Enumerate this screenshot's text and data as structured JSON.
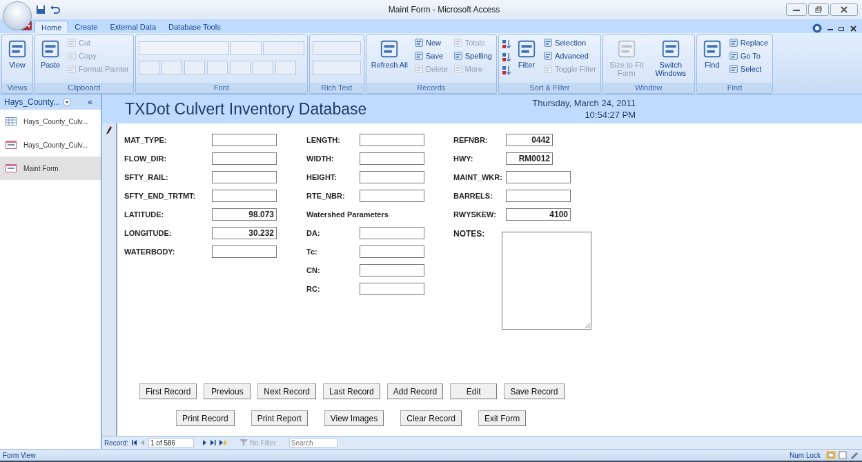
{
  "window": {
    "title": "Maint Form - Microsoft Access"
  },
  "ribbon_tabs": [
    {
      "label": "Home",
      "selected": true
    },
    {
      "label": "Create",
      "selected": false
    },
    {
      "label": "External Data",
      "selected": false
    },
    {
      "label": "Database Tools",
      "selected": false
    }
  ],
  "ribbon_groups": [
    {
      "name": "Views",
      "columns": [
        {
          "kind": "large",
          "items": [
            {
              "label": "View",
              "disabled": false
            }
          ]
        }
      ]
    },
    {
      "name": "Clipboard",
      "columns": [
        {
          "kind": "large",
          "items": [
            {
              "label": "Paste",
              "disabled": false
            }
          ]
        },
        {
          "kind": "small",
          "items": [
            {
              "label": "Cut",
              "disabled": true
            },
            {
              "label": "Copy",
              "disabled": true
            },
            {
              "label": "Format Painter",
              "disabled": true
            }
          ]
        }
      ]
    },
    {
      "name": "Font",
      "columns": [
        {
          "kind": "font"
        }
      ]
    },
    {
      "name": "Rich Text",
      "columns": [
        {
          "kind": "richtext"
        }
      ]
    },
    {
      "name": "Records",
      "columns": [
        {
          "kind": "large",
          "items": [
            {
              "label": "Refresh All",
              "disabled": false
            }
          ]
        },
        {
          "kind": "small",
          "items": [
            {
              "label": "New",
              "disabled": false
            },
            {
              "label": "Save",
              "disabled": false
            },
            {
              "label": "Delete",
              "disabled": true
            }
          ]
        },
        {
          "kind": "small",
          "items": [
            {
              "label": "Totals",
              "disabled": true
            },
            {
              "label": "Spelling",
              "disabled": false
            },
            {
              "label": "More",
              "disabled": true
            }
          ]
        }
      ]
    },
    {
      "name": "Sort & Filter",
      "columns": [
        {
          "kind": "sort"
        },
        {
          "kind": "large",
          "items": [
            {
              "label": "Filter",
              "disabled": false
            }
          ]
        },
        {
          "kind": "small",
          "items": [
            {
              "label": "Selection",
              "disabled": false
            },
            {
              "label": "Advanced",
              "disabled": false
            },
            {
              "label": "Toggle Filter",
              "disabled": true
            }
          ]
        }
      ]
    },
    {
      "name": "Window",
      "columns": [
        {
          "kind": "large",
          "items": [
            {
              "label": "Size to Fit Form",
              "disabled": true
            }
          ]
        },
        {
          "kind": "large",
          "items": [
            {
              "label": "Switch Windows",
              "disabled": false
            }
          ]
        }
      ]
    },
    {
      "name": "Find",
      "columns": [
        {
          "kind": "large",
          "items": [
            {
              "label": "Find",
              "disabled": false
            }
          ]
        },
        {
          "kind": "small",
          "items": [
            {
              "label": "Replace",
              "disabled": false
            },
            {
              "label": "Go To",
              "disabled": false
            },
            {
              "label": "Select",
              "disabled": false
            }
          ]
        }
      ]
    }
  ],
  "nav_pane": {
    "header": "Hays_County...",
    "collapse": "«",
    "items": [
      {
        "label": "Hays_County_Culv...",
        "kind": "table",
        "selected": false
      },
      {
        "label": "Hays_County_Culv...",
        "kind": "form",
        "selected": false
      },
      {
        "label": "Maint Form",
        "kind": "form",
        "selected": true
      }
    ]
  },
  "form": {
    "title": "TXDot Culvert Inventory Database",
    "date": "Thursday, March 24, 2011",
    "time": "10:54:27 PM",
    "columns": [
      [
        {
          "kind": "field",
          "label": "MAT_TYPE:"
        },
        {
          "kind": "field",
          "label": "FLOW_DIR:"
        },
        {
          "kind": "field",
          "label": "SFTY_RAIL:"
        },
        {
          "kind": "field",
          "label": "SFTY_END_TRTMT:"
        },
        {
          "kind": "field",
          "label": "LATITUDE:",
          "value": "98.073"
        },
        {
          "kind": "field",
          "label": "LONGITUDE:",
          "value": "30.232"
        },
        {
          "kind": "field",
          "label": "WATERBODY:"
        }
      ],
      [
        {
          "kind": "field",
          "label": "LENGTH:"
        },
        {
          "kind": "field",
          "label": "WIDTH:"
        },
        {
          "kind": "field",
          "label": "HEIGHT:"
        },
        {
          "kind": "field",
          "label": "RTE_NBR:"
        },
        {
          "kind": "heading",
          "label": "Watershed Parameters"
        },
        {
          "kind": "field",
          "label": "DA:"
        },
        {
          "kind": "field",
          "label": "Tc:"
        },
        {
          "kind": "field",
          "label": "CN:"
        },
        {
          "kind": "field",
          "label": "RC:"
        }
      ],
      [
        {
          "kind": "narrow",
          "label": "REFNBR:",
          "value": "0442"
        },
        {
          "kind": "narrow",
          "label": "HWY:",
          "value": "RM0012"
        },
        {
          "kind": "field",
          "label": "MAINT_WKR:"
        },
        {
          "kind": "field",
          "label": "BARRELS:"
        },
        {
          "kind": "field",
          "label": "RWYSKEW:",
          "value": "4100"
        },
        {
          "kind": "memo",
          "label": "NOTES:"
        }
      ]
    ],
    "button_rows": [
      [
        "First Record",
        "Previous",
        "Next Record",
        "Last Record",
        "Add Record",
        "Edit",
        "Save Record"
      ],
      [
        "Print Record",
        "Print Report",
        "View Images",
        "Clear Record",
        "Exit Form"
      ]
    ]
  },
  "record_bar": {
    "label": "Record:",
    "position": "1 of 586",
    "filter": "No Filter",
    "search_placeholder": "Search"
  },
  "status_bar": {
    "view": "Form View",
    "num_lock": "Num Lock"
  }
}
